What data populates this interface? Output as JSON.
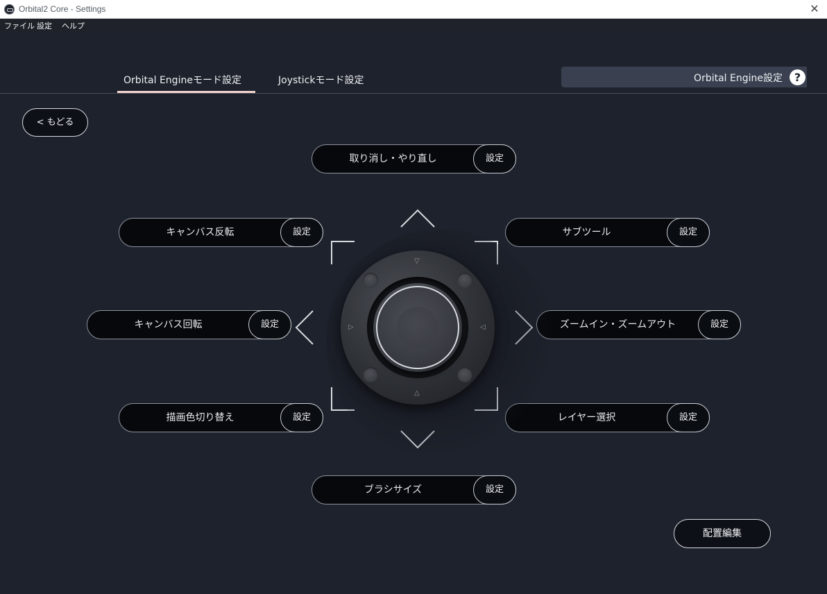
{
  "window": {
    "title": "Orbital2 Core - Settings",
    "close_glyph": "✕"
  },
  "menu": {
    "items": [
      "ファイル",
      "設定",
      "ヘルプ"
    ]
  },
  "tabs": [
    {
      "label": "Orbital Engineモード設定",
      "active": true
    },
    {
      "label": "Joystickモード設定",
      "active": false
    }
  ],
  "header": {
    "label": "Orbital Engine設定",
    "help_glyph": "?"
  },
  "back_button": {
    "label": "< もどる"
  },
  "set_label": "設定",
  "functions": {
    "up": "取り消し・やり直し",
    "upper_left": "キャンバス反転",
    "upper_right": "サブツール",
    "left": "キャンバス回転",
    "right": "ズームイン・ズームアウト",
    "lower_left": "描画色切り替え",
    "lower_right": "レイヤー選択",
    "down": "ブラシサイズ"
  },
  "edit_button": {
    "label": "配置編集"
  },
  "device_marks": {
    "top": "▽",
    "bottom": "△",
    "left": "▷",
    "right": "◁"
  },
  "colors": {
    "background": "#1e222c",
    "pill": "#06080c",
    "active_tab_underline": "#f5d7cf",
    "header_bar": "#3a4050"
  }
}
